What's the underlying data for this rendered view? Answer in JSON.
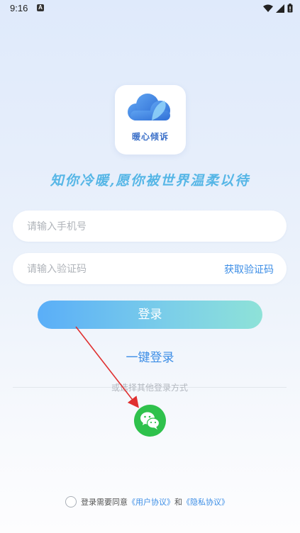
{
  "status_bar": {
    "time": "9:16",
    "notif_letter": "A"
  },
  "logo": {
    "brand_text": "暖心倾诉"
  },
  "slogan": "知你冷暖,愿你被世界温柔以待",
  "phone_input": {
    "placeholder": "请输入手机号",
    "value": ""
  },
  "code_input": {
    "placeholder": "请输入验证码",
    "value": ""
  },
  "get_code_label": "获取验证码",
  "login_button": "登录",
  "one_key_login": "一键登录",
  "divider_text": "或选择其他登录方式",
  "agreement": {
    "prefix": "登录需要同意",
    "user_agreement": "《用户协议》",
    "and": "和",
    "privacy_policy": "《隐私协议》"
  },
  "colors": {
    "accent": "#3d8ee6",
    "wechat": "#2fc14c",
    "annotation_arrow": "#e03030"
  }
}
